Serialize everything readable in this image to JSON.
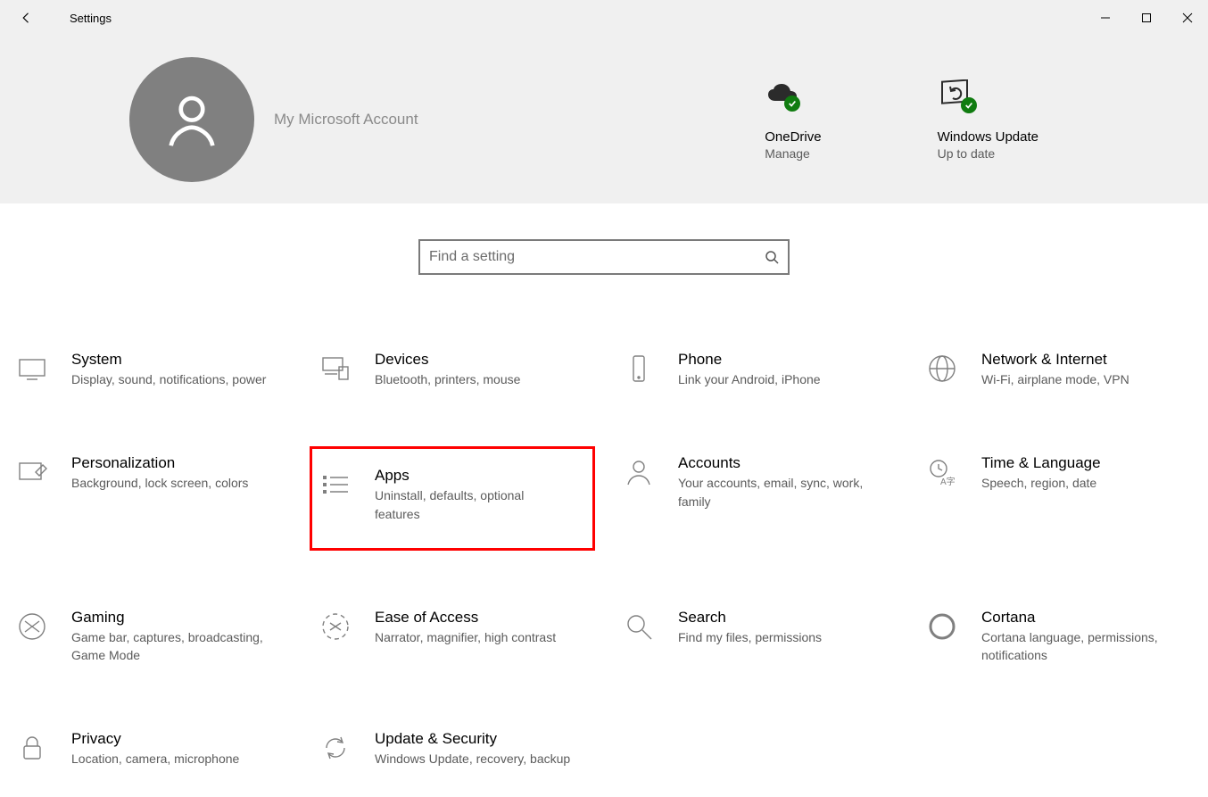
{
  "window": {
    "title": "Settings"
  },
  "hero": {
    "account_name": "My Microsoft Account",
    "tiles": [
      {
        "title": "OneDrive",
        "sub": "Manage"
      },
      {
        "title": "Windows Update",
        "sub": "Up to date"
      }
    ]
  },
  "search": {
    "placeholder": "Find a setting"
  },
  "categories": [
    {
      "icon": "display",
      "title": "System",
      "sub": "Display, sound, notifications, power"
    },
    {
      "icon": "devices",
      "title": "Devices",
      "sub": "Bluetooth, printers, mouse"
    },
    {
      "icon": "phone",
      "title": "Phone",
      "sub": "Link your Android, iPhone"
    },
    {
      "icon": "network",
      "title": "Network & Internet",
      "sub": "Wi-Fi, airplane mode, VPN"
    },
    {
      "icon": "personalize",
      "title": "Personalization",
      "sub": "Background, lock screen, colors"
    },
    {
      "icon": "apps",
      "title": "Apps",
      "sub": "Uninstall, defaults, optional features",
      "highlighted": true
    },
    {
      "icon": "accounts",
      "title": "Accounts",
      "sub": "Your accounts, email, sync, work, family"
    },
    {
      "icon": "time",
      "title": "Time & Language",
      "sub": "Speech, region, date"
    },
    {
      "icon": "gaming",
      "title": "Gaming",
      "sub": "Game bar, captures, broadcasting, Game Mode"
    },
    {
      "icon": "ease",
      "title": "Ease of Access",
      "sub": "Narrator, magnifier, high contrast"
    },
    {
      "icon": "search",
      "title": "Search",
      "sub": "Find my files, permissions"
    },
    {
      "icon": "cortana",
      "title": "Cortana",
      "sub": "Cortana language, permissions, notifications"
    },
    {
      "icon": "privacy",
      "title": "Privacy",
      "sub": "Location, camera, microphone"
    },
    {
      "icon": "update",
      "title": "Update & Security",
      "sub": "Windows Update, recovery, backup"
    }
  ]
}
